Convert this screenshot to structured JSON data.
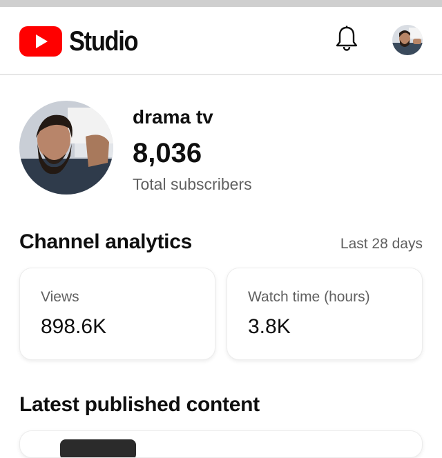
{
  "app": {
    "brand": "Studio",
    "brand_color": "#ff0000",
    "icons": {
      "logo": "youtube-play-icon",
      "notifications": "bell-icon",
      "account": "avatar"
    }
  },
  "profile": {
    "channel_name": "drama tv",
    "subscriber_count": "8,036",
    "subscriber_label": "Total subscribers"
  },
  "analytics": {
    "title": "Channel analytics",
    "period": "Last 28 days",
    "cards": [
      {
        "label": "Views",
        "value": "898.6K"
      },
      {
        "label": "Watch time (hours)",
        "value": "3.8K"
      }
    ]
  },
  "latest": {
    "title": "Latest published content"
  }
}
